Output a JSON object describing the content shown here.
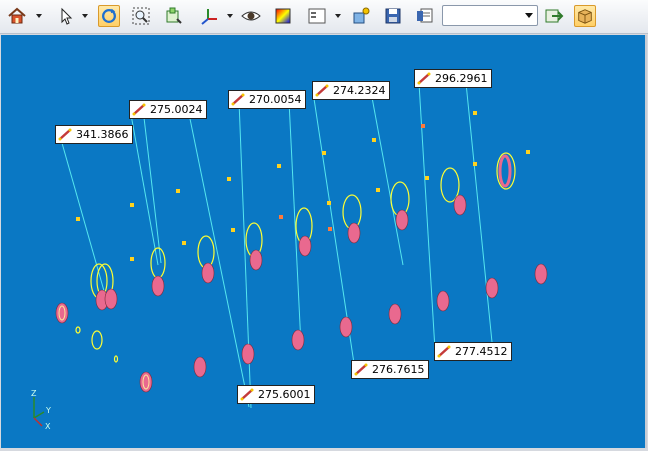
{
  "toolbar": {
    "items": [
      {
        "name": "home-icon",
        "dropdown": true
      },
      {
        "name": "select-pointer-icon",
        "dropdown": true
      },
      {
        "name": "rotate-icon",
        "active": true
      },
      {
        "name": "zoom-fit-icon"
      },
      {
        "name": "zoom-window-icon"
      },
      {
        "name": "axes-view-icon",
        "dropdown": true
      },
      {
        "name": "eye-icon"
      },
      {
        "name": "render-color-icon"
      },
      {
        "name": "layout-panel-icon",
        "dropdown": true
      },
      {
        "name": "new-item-icon"
      },
      {
        "name": "save-view-icon"
      },
      {
        "name": "properties-icon"
      }
    ],
    "view_combo_value": "",
    "trailing_items": [
      {
        "name": "export-icon"
      },
      {
        "name": "package-icon"
      }
    ]
  },
  "measurements": [
    {
      "value": "341.3866"
    },
    {
      "value": "275.0024"
    },
    {
      "value": "270.0054"
    },
    {
      "value": "274.2324"
    },
    {
      "value": "296.2961"
    },
    {
      "value": "275.6001"
    },
    {
      "value": "276.7615"
    },
    {
      "value": "277.4512"
    }
  ],
  "triad": {
    "x": "X",
    "y": "Y",
    "z": "Z"
  },
  "colors": {
    "viewport_bg": "#0a78c4",
    "measure_line": "#55e6ef",
    "ring_fill": "#e9698f",
    "ring_outline": "#ffff33",
    "marker": "#ffd21e"
  }
}
